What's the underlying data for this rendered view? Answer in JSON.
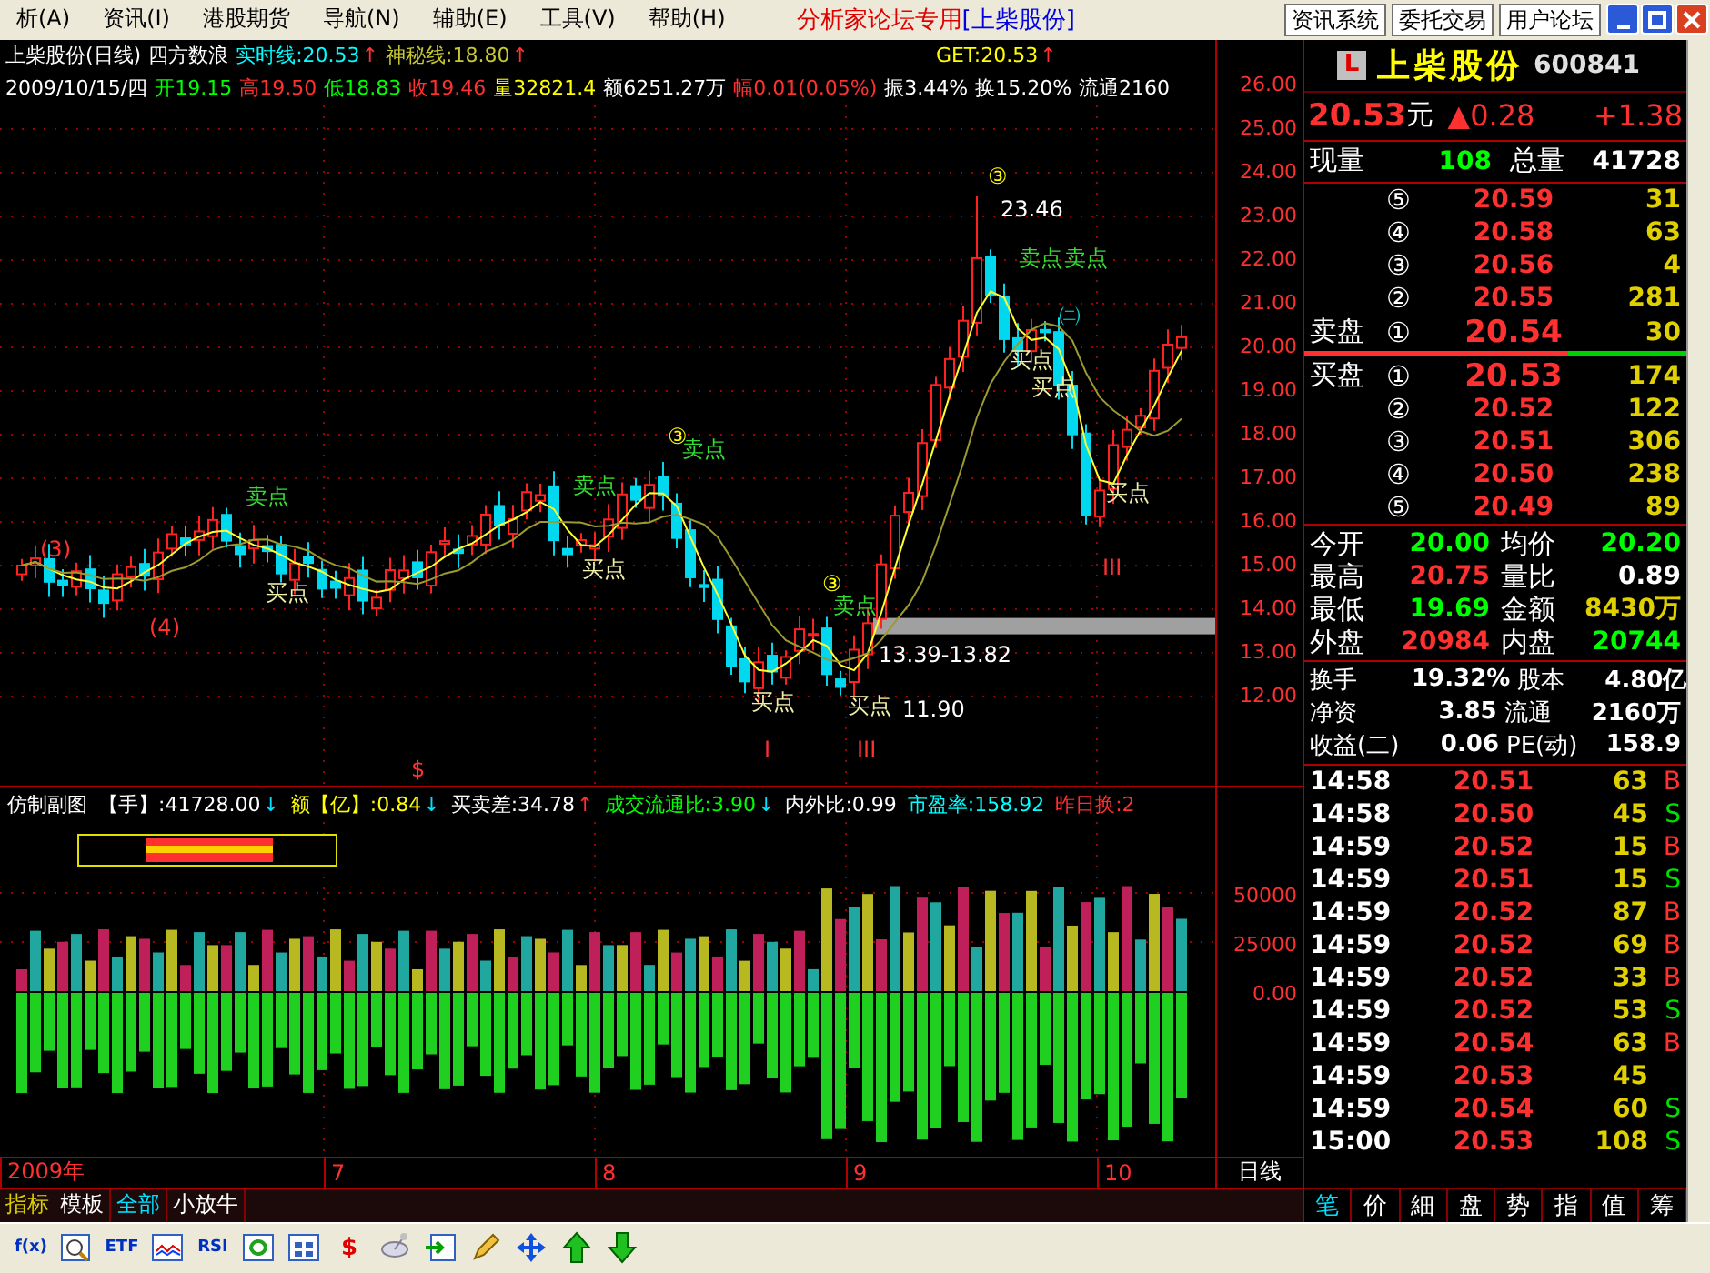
{
  "menu": {
    "items": [
      "析(A)",
      "资讯(I)",
      "港股期货",
      "导航(N)",
      "辅助(E)",
      "工具(V)",
      "帮助(H)"
    ],
    "title": "分析家论坛专用",
    "stock": "[上柴股份]",
    "buttons": [
      "资讯系统",
      "委托交易",
      "用户论坛"
    ]
  },
  "chart": {
    "title": "上柴股份(日线)",
    "study": "四方数浪",
    "lines": [
      {
        "label": "实时线:20.53",
        "color": "#00ffff",
        "arrow": {
          "text": "↑",
          "color": "#ff3030"
        }
      },
      {
        "label": "神秘线:18.80",
        "color": "#c8c832",
        "arrow": {
          "text": "↑",
          "color": "#ff3030"
        }
      },
      {
        "label": "GET:20.53",
        "color": "#ffff00",
        "arrow": {
          "text": "↑",
          "color": "#ff3030"
        }
      }
    ],
    "date": "2009/10/15/四",
    "stats": [
      {
        "text": "开19.15",
        "color": "#00ff00"
      },
      {
        "text": "高19.50",
        "color": "#ff3030"
      },
      {
        "text": "低18.83",
        "color": "#00ff00"
      },
      {
        "text": "收19.46",
        "color": "#ff3030"
      },
      {
        "text": "量32821.4",
        "color": "#ffff00"
      },
      {
        "text": "额6251.27万",
        "color": "#ffffff"
      },
      {
        "text": "幅0.01(0.05%)",
        "color": "#ff3030"
      },
      {
        "text": "振3.44%",
        "color": "#ffffff"
      },
      {
        "text": "换15.20%",
        "color": "#ffffff"
      },
      {
        "text": "流通2160",
        "color": "#ffffff"
      }
    ],
    "price_axis": [
      "26.00",
      "25.00",
      "24.00",
      "23.00",
      "22.00",
      "21.00",
      "20.00",
      "19.00",
      "18.00",
      "17.00",
      "16.00",
      "15.00",
      "14.00",
      "13.00",
      "12.00"
    ],
    "annotations": [
      {
        "text": "③",
        "kind": "wave"
      },
      {
        "text": "23.46",
        "kind": "price"
      },
      {
        "text": "卖点",
        "kind": "sell"
      },
      {
        "text": "卖点",
        "kind": "sell"
      },
      {
        "text": "㈡",
        "kind": "circle"
      },
      {
        "text": "买点",
        "kind": "buy"
      },
      {
        "text": "买点",
        "kind": "buy"
      },
      {
        "text": "③",
        "kind": "wave"
      },
      {
        "text": "卖点",
        "kind": "sell"
      },
      {
        "text": "卖点",
        "kind": "sell"
      },
      {
        "text": "卖点",
        "kind": "sell"
      },
      {
        "text": "买点",
        "kind": "buy"
      },
      {
        "text": "(3)",
        "kind": "count"
      },
      {
        "text": "买点",
        "kind": "buy"
      },
      {
        "text": "买点",
        "kind": "buy"
      },
      {
        "text": "③",
        "kind": "wave"
      },
      {
        "text": "卖点",
        "kind": "sell"
      },
      {
        "text": "III",
        "kind": "count"
      },
      {
        "text": "(4)",
        "kind": "count"
      },
      {
        "text": "13.39-13.82",
        "kind": "price"
      },
      {
        "text": "买点",
        "kind": "buy"
      },
      {
        "text": "买点",
        "kind": "buy"
      },
      {
        "text": "11.90",
        "kind": "price"
      },
      {
        "text": "$",
        "kind": "count"
      },
      {
        "text": "I",
        "kind": "count"
      },
      {
        "text": "III",
        "kind": "count"
      }
    ]
  },
  "indicator": {
    "title": "仿制副图",
    "items": [
      {
        "text": "【手】:41728.00",
        "color": "#ffffff",
        "arrow": {
          "text": "↓",
          "color": "#00e0ff"
        }
      },
      {
        "text": "额【亿】:0.84",
        "color": "#ffff00",
        "arrow": {
          "text": "↓",
          "color": "#00e0ff"
        }
      },
      {
        "text": "买卖差:34.78",
        "color": "#ffffff",
        "arrow": {
          "text": "↑",
          "color": "#ff3030"
        }
      },
      {
        "text": "成交流通比:3.90",
        "color": "#00ff00",
        "arrow": {
          "text": "↓",
          "color": "#00e0ff"
        }
      },
      {
        "text": "内外比:0.99",
        "color": "#ffffff"
      },
      {
        "text": "市盈率:158.92",
        "color": "#00ffff"
      },
      {
        "text": "昨日换:2",
        "color": "#ff3030"
      }
    ],
    "axis": [
      "50000",
      "25000",
      "0.00"
    ]
  },
  "time_axis": [
    "2009年",
    "7",
    "8",
    "9",
    "10"
  ],
  "period": "日线",
  "tabs": [
    {
      "label": "指标",
      "kind": "heading",
      "selected": false
    },
    {
      "label": "模板",
      "kind": "tab",
      "selected": false
    },
    {
      "label": "全部",
      "kind": "tab",
      "selected": true
    },
    {
      "label": "小放牛",
      "kind": "tab",
      "selected": false
    }
  ],
  "quote": {
    "badge": "L",
    "name": "上柴股份",
    "code": "600841",
    "price": "20.53",
    "unit": "元",
    "change": "▲0.28",
    "change2": "+1.38",
    "volume_now": {
      "label": "现量",
      "value": "108"
    },
    "volume_total": {
      "label": "总量",
      "value": "41728"
    },
    "asks": [
      {
        "rank": "⑤",
        "price": "20.59",
        "volume": "31"
      },
      {
        "rank": "④",
        "price": "20.58",
        "volume": "63"
      },
      {
        "rank": "③",
        "price": "20.56",
        "volume": "4"
      },
      {
        "rank": "②",
        "price": "20.55",
        "volume": "281"
      },
      {
        "rank": "①",
        "price": "20.54",
        "volume": "30",
        "label": "卖盘"
      }
    ],
    "ratio": {
      "level": 0.69
    },
    "bids": [
      {
        "rank": "①",
        "price": "20.53",
        "volume": "174",
        "label": "买盘"
      },
      {
        "rank": "②",
        "price": "20.52",
        "volume": "122"
      },
      {
        "rank": "③",
        "price": "20.51",
        "volume": "306"
      },
      {
        "rank": "④",
        "price": "20.50",
        "volume": "238"
      },
      {
        "rank": "⑤",
        "price": "20.49",
        "volume": "89"
      }
    ],
    "stats": [
      [
        {
          "label": "今开",
          "value": "20.00",
          "color": "#00ff00"
        },
        {
          "label": "均价",
          "value": "20.20",
          "color": "#00ff00"
        }
      ],
      [
        {
          "label": "最高",
          "value": "20.75",
          "color": "#ff3030"
        },
        {
          "label": "量比",
          "value": "0.89",
          "color": "#ffffff"
        }
      ],
      [
        {
          "label": "最低",
          "value": "19.69",
          "color": "#00ff00"
        },
        {
          "label": "金额",
          "value": "8430万",
          "color": "#e0d000"
        }
      ],
      [
        {
          "label": "外盘",
          "value": "20984",
          "color": "#ff3030"
        },
        {
          "label": "内盘",
          "value": "20744",
          "color": "#00ff00"
        }
      ]
    ],
    "finance": [
      [
        {
          "label": "换手",
          "value": "19.32%"
        },
        {
          "label": "股本",
          "value": "4.80亿"
        }
      ],
      [
        {
          "label": "净资",
          "value": "3.85"
        },
        {
          "label": "流通",
          "value": "2160万"
        }
      ],
      [
        {
          "label": "收益(二)",
          "value": "0.06"
        },
        {
          "label": "PE(动)",
          "value": "158.9"
        }
      ]
    ],
    "ticks": [
      {
        "time": "14:58",
        "price": "20.51",
        "volume": "63",
        "flag": {
          "text": "B",
          "color": "#ff3030"
        }
      },
      {
        "time": "14:58",
        "price": "20.50",
        "volume": "45",
        "flag": {
          "text": "S",
          "color": "#00e000"
        }
      },
      {
        "time": "14:59",
        "price": "20.52",
        "volume": "15",
        "flag": {
          "text": "B",
          "color": "#ff3030"
        }
      },
      {
        "time": "14:59",
        "price": "20.51",
        "volume": "15",
        "flag": {
          "text": "S",
          "color": "#00e000"
        }
      },
      {
        "time": "14:59",
        "price": "20.52",
        "volume": "87",
        "flag": {
          "text": "B",
          "color": "#ff3030"
        }
      },
      {
        "time": "14:59",
        "price": "20.52",
        "volume": "69",
        "flag": {
          "text": "B",
          "color": "#ff3030"
        }
      },
      {
        "time": "14:59",
        "price": "20.52",
        "volume": "33",
        "flag": {
          "text": "B",
          "color": "#ff3030"
        }
      },
      {
        "time": "14:59",
        "price": "20.52",
        "volume": "53",
        "flag": {
          "text": "S",
          "color": "#00e000"
        }
      },
      {
        "time": "14:59",
        "price": "20.54",
        "volume": "63",
        "flag": {
          "text": "B",
          "color": "#ff3030"
        }
      },
      {
        "time": "14:59",
        "price": "20.53",
        "volume": "45"
      },
      {
        "time": "14:59",
        "price": "20.54",
        "volume": "60",
        "flag": {
          "text": "S",
          "color": "#00e000"
        }
      },
      {
        "time": "15:00",
        "price": "20.53",
        "volume": "108",
        "flag": {
          "text": "S",
          "color": "#00e000"
        }
      }
    ],
    "tabs": [
      {
        "label": "笔",
        "selected": true
      },
      {
        "label": "价",
        "selected": false
      },
      {
        "label": "細",
        "selected": false
      },
      {
        "label": "盘",
        "selected": false
      },
      {
        "label": "势",
        "selected": false
      },
      {
        "label": "指",
        "selected": false
      },
      {
        "label": "值",
        "selected": false
      },
      {
        "label": "筹",
        "selected": false
      }
    ]
  },
  "toolbar": [
    {
      "kind": "text",
      "label": "f(x)"
    },
    {
      "kind": "magnifier"
    },
    {
      "kind": "text",
      "label": "ETF"
    },
    {
      "kind": "chart"
    },
    {
      "kind": "text",
      "label": "RSI"
    },
    {
      "kind": "refresh"
    },
    {
      "kind": "grid"
    },
    {
      "kind": "text",
      "label": "$"
    },
    {
      "kind": "satellite"
    },
    {
      "kind": "enter"
    },
    {
      "kind": "pencil"
    },
    {
      "kind": "move"
    },
    {
      "kind": "up"
    },
    {
      "kind": "down"
    }
  ]
}
